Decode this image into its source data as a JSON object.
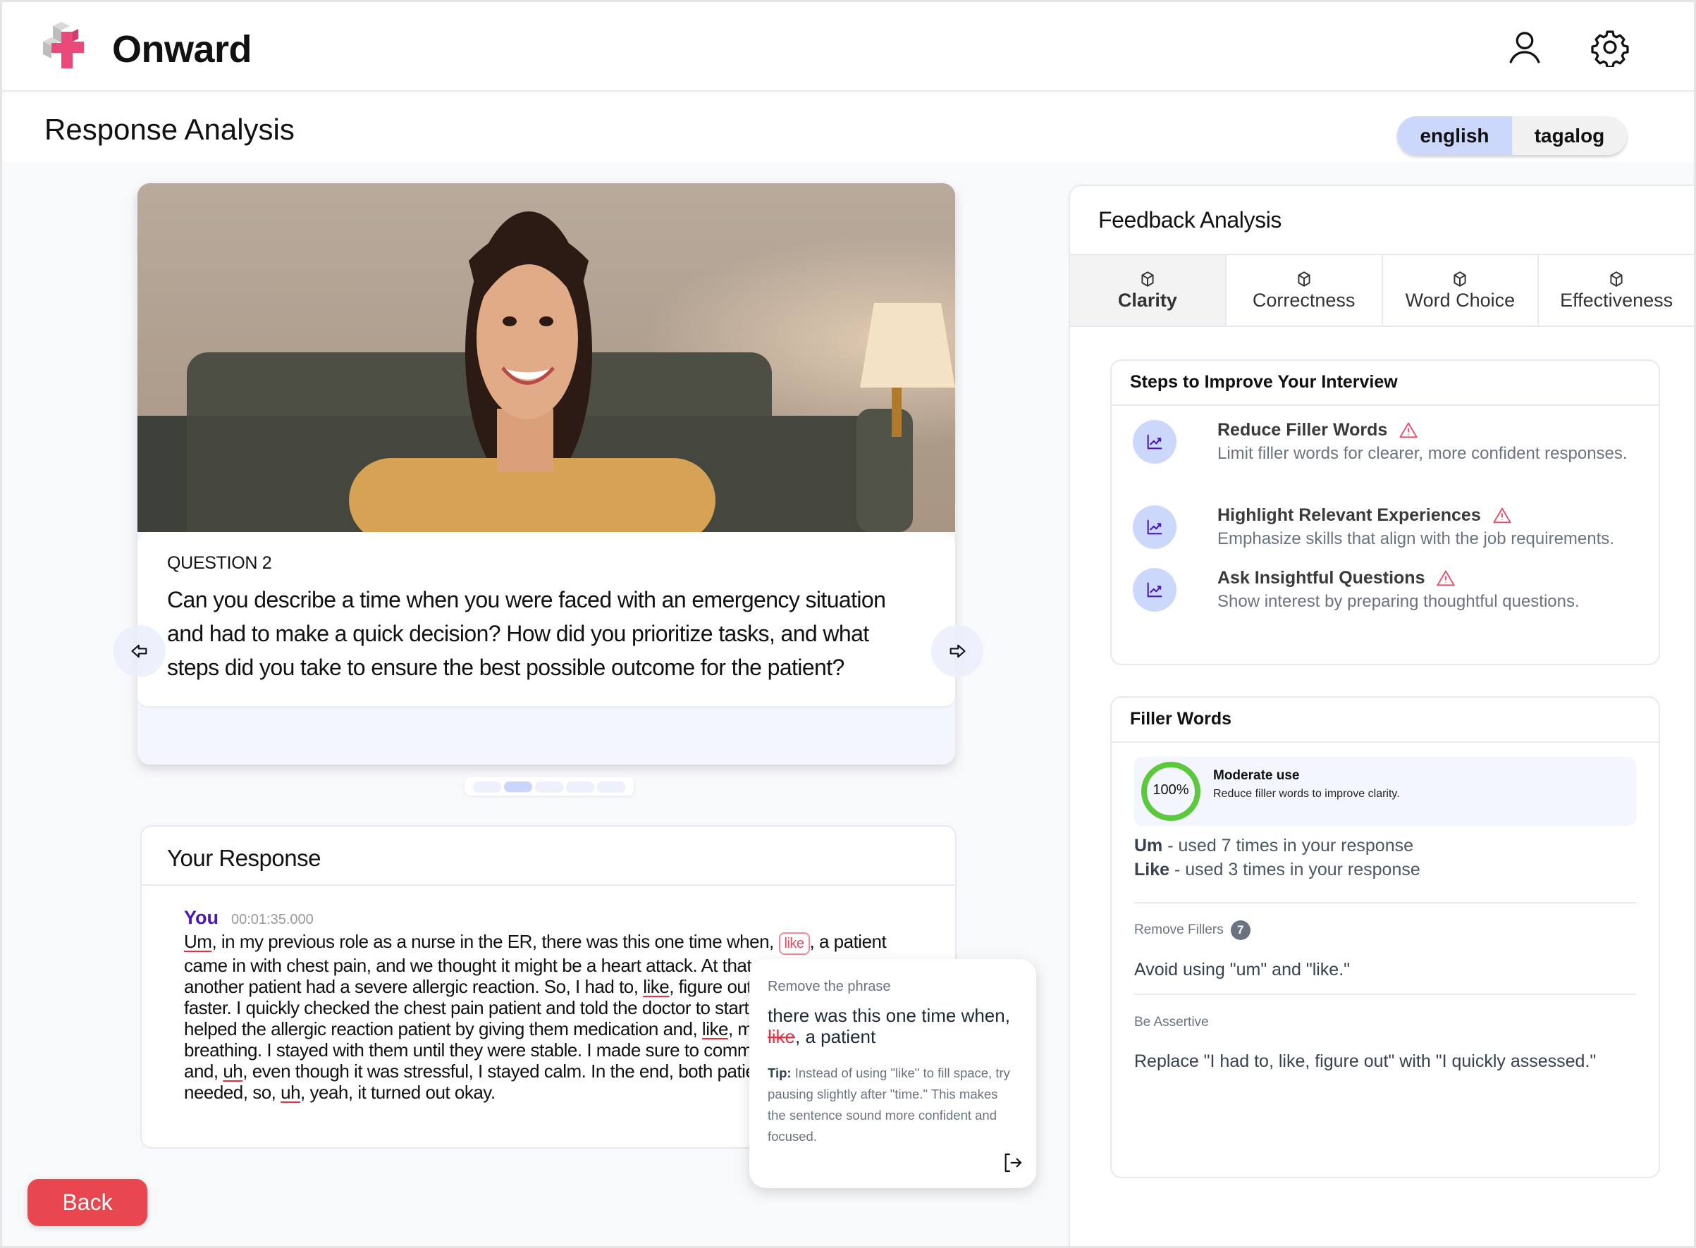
{
  "app": {
    "brand": "Onward",
    "brand_color": "#e94a7a",
    "header_icons": [
      "user-icon",
      "gear-icon"
    ]
  },
  "page": {
    "title": "Response Analysis",
    "languages": [
      {
        "label": "english",
        "active": true
      },
      {
        "label": "tagalog",
        "active": false
      }
    ]
  },
  "question": {
    "label": "QUESTION 2",
    "text": "Can you describe a time when you were faced with an emergency situation and had to make a quick decision? How did you prioritize tasks, and what steps did you take to ensure the best possible outcome for the patient?",
    "current_index": 2,
    "total": 5
  },
  "response": {
    "title": "Your Response",
    "speaker": "You",
    "timestamp": "00:01:35.000",
    "segments": [
      {
        "t": "Um",
        "f": "u"
      },
      {
        "t": ", in my previous role as a nurse in the ER, there was this one time when, "
      },
      {
        "t": "like",
        "f": "box"
      },
      {
        "t": ", a patient came in with chest pain, and we thought it might be a heart attack. At that same moment, another patient had a severe allergic reaction. So, I had to, "
      },
      {
        "t": "like",
        "f": "u"
      },
      {
        "t": ", figure out who needed help faster. I quickly checked the chest pain patient and told the doctor to start treatment while I, "
      },
      {
        "t": "uh",
        "f": "u"
      },
      {
        "t": ", helped the allergic reaction patient by giving them medication and, "
      },
      {
        "t": "like",
        "f": "u"
      },
      {
        "t": ", monitoring their breathing. I stayed with them until they were stable. I made sure to communicate with my team, and, "
      },
      {
        "t": "uh",
        "f": "u"
      },
      {
        "t": ", even though it was stressful, I stayed calm. In the end, both patients got the care they needed, so, "
      },
      {
        "t": "uh",
        "f": "u"
      },
      {
        "t": ", yeah, it turned out okay."
      }
    ]
  },
  "popover": {
    "label": "Remove the phrase",
    "phrase_before": "there was this one time when, ",
    "phrase_struck": "like",
    "phrase_after": ", a patient",
    "tip_label": "Tip:",
    "tip_text": " Instead of using \"like\" to fill space, try pausing slightly after \"time.\" This makes the sentence sound more confident and focused."
  },
  "back_label": "Back",
  "feedback": {
    "title": "Feedback Analysis",
    "tabs": [
      {
        "label": "Clarity",
        "active": true
      },
      {
        "label": "Correctness",
        "active": false
      },
      {
        "label": "Word Choice",
        "active": false
      },
      {
        "label": "Effectiveness",
        "active": false
      }
    ],
    "steps_title": "Steps to Improve Your Interview",
    "steps": [
      {
        "title": "Reduce Filler Words",
        "desc": "Limit filler words for clearer, more confident responses."
      },
      {
        "title": "Highlight Relevant Experiences",
        "desc": "Emphasize skills that align with the job requirements."
      },
      {
        "title": "Ask Insightful Questions",
        "desc": "Show interest by preparing thoughtful questions."
      }
    ],
    "filler": {
      "title": "Filler Words",
      "percent": 100,
      "percent_label": "100%",
      "usage_title": "Moderate use",
      "usage_desc": "Reduce filler words to improve clarity.",
      "counts": [
        {
          "word": "Um",
          "text": " - used 7 times in your response"
        },
        {
          "word": "Like",
          "text": " - used 3 times in your response"
        }
      ],
      "remove_label": "Remove Fillers",
      "remove_count": "7",
      "remove_text": "Avoid using \"um\" and \"like.\"",
      "assertive_label": "Be Assertive",
      "assertive_text": "Replace \"I had to, like, figure out\" with \"I quickly assessed.\""
    }
  }
}
